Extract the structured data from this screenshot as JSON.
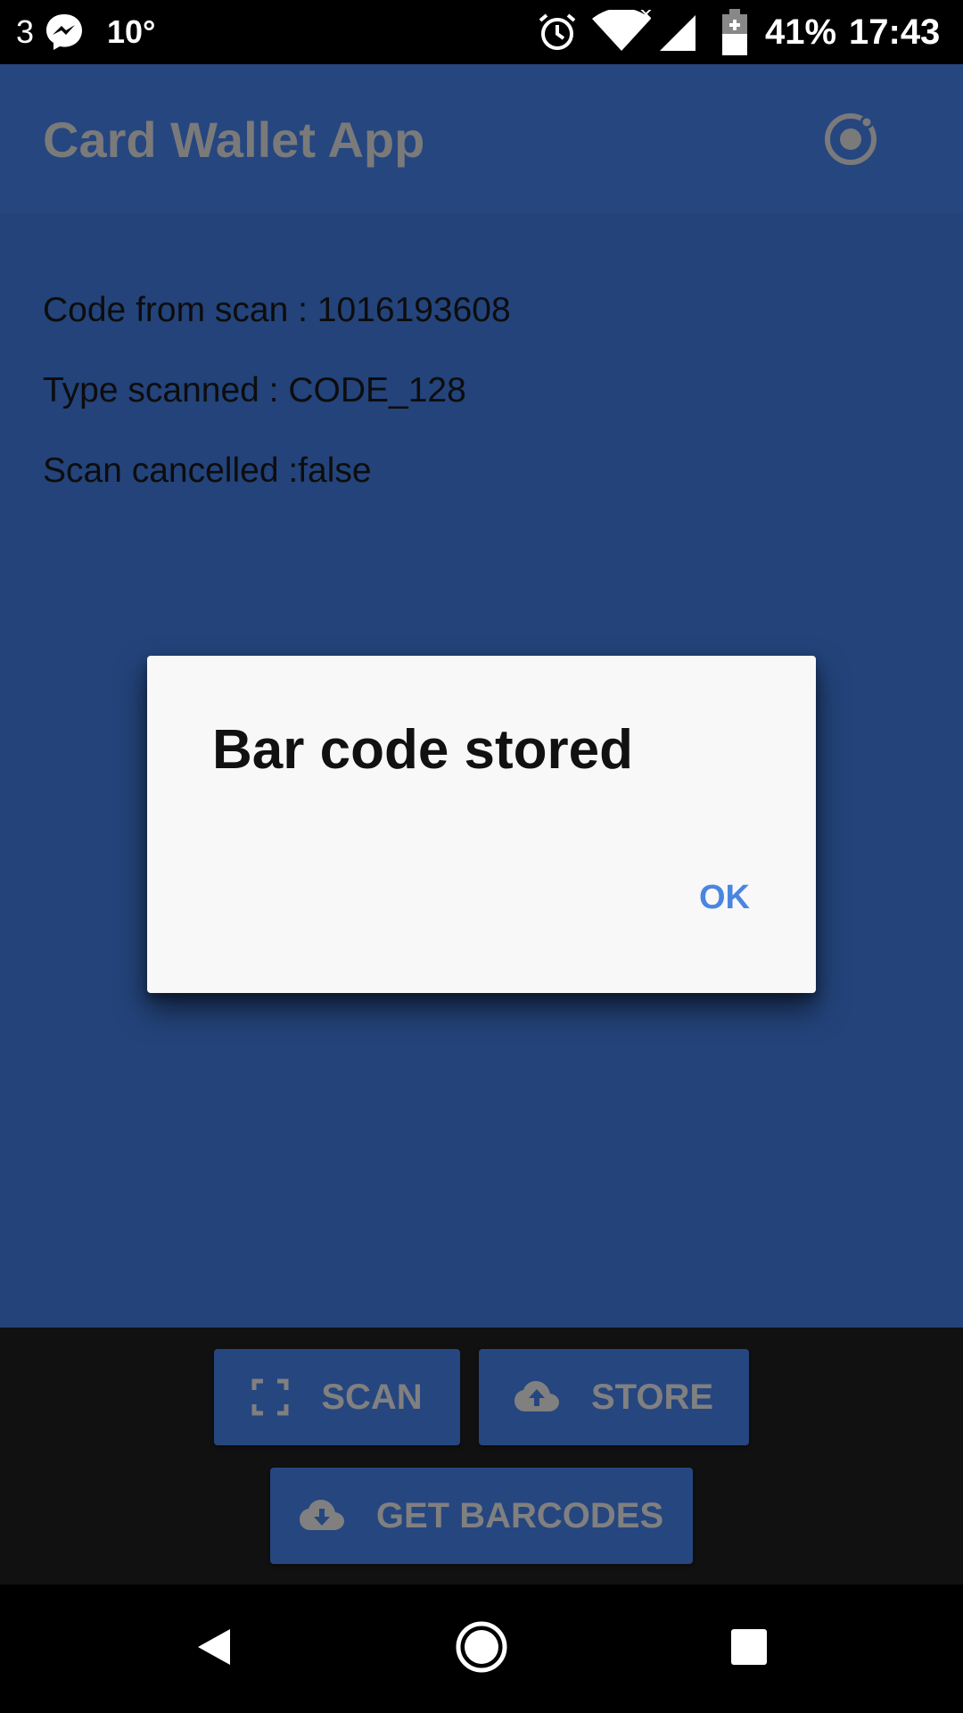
{
  "status_bar": {
    "notification_count": "3",
    "temperature": "10°",
    "battery_percent": "41%",
    "time": "17:43",
    "icons": [
      "messenger-icon",
      "alarm-icon",
      "wifi-icon",
      "signal-icon",
      "battery-icon"
    ]
  },
  "app_bar": {
    "title": "Card Wallet App",
    "icon": "ionic-logo-icon"
  },
  "scan_info": {
    "code_line": "Code from scan : 1016193608",
    "type_line": "Type scanned : CODE_128",
    "cancelled_line": "Scan cancelled :false"
  },
  "dialog": {
    "title": "Bar code stored",
    "ok_label": "OK"
  },
  "footer": {
    "scan_label": "SCAN",
    "store_label": "STORE",
    "get_barcodes_label": "GET BARCODES"
  },
  "nav_bar": {
    "icons": [
      "back-icon",
      "home-icon",
      "recents-icon"
    ]
  },
  "colors": {
    "app_bar": "#26467f",
    "content_bg": "#23437a",
    "dialog_bg": "#f8f8f8",
    "dialog_button": "#4a86e0",
    "footer_bg": "#111111",
    "button_text": "#808080"
  }
}
